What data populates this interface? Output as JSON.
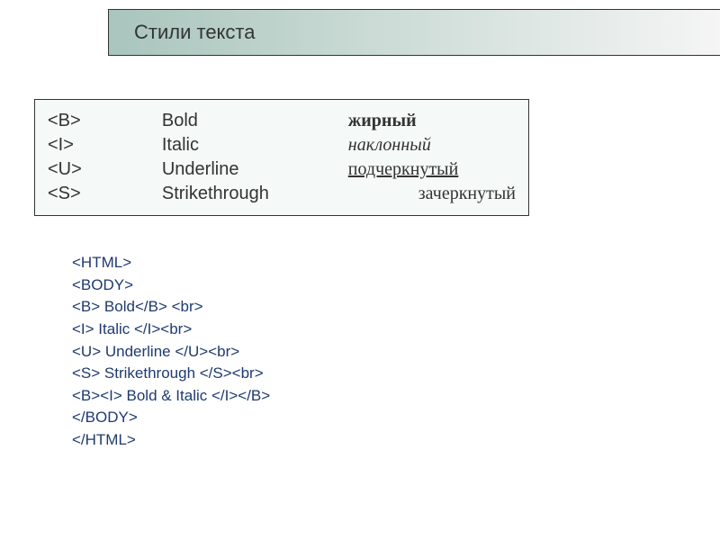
{
  "header": {
    "title": "Стили текста"
  },
  "table": {
    "rows": [
      {
        "tag": "<B>",
        "eng": "Bold",
        "rus": "жирный",
        "style": "bold"
      },
      {
        "tag": "<I>",
        "eng": "Italic",
        "rus": "наклонный",
        "style": "italic"
      },
      {
        "tag": "<U>",
        "eng": "Underline",
        "rus": "подчеркнутый",
        "style": "underline"
      },
      {
        "tag": "<S>",
        "eng": "Strikethrough",
        "rus": "зачеркнутый",
        "style": "plain"
      }
    ]
  },
  "code": {
    "lines": [
      "<HTML>",
      "<BODY>",
      "<B> Bold</B> <br>",
      "<I> Italic </I><br>",
      "<U> Underline </U><br>",
      "<S> Strikethrough </S><br>",
      "<B><I> Bold & Italic </I></B>",
      "</BODY>",
      "</HTML>"
    ]
  }
}
